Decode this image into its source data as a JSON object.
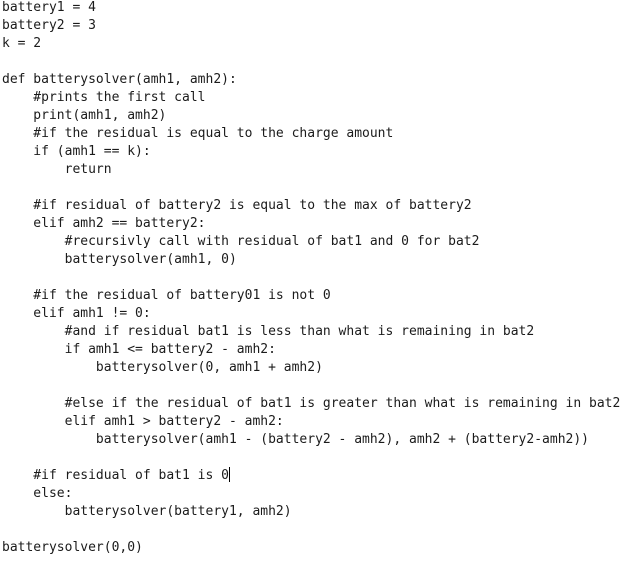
{
  "editor": {
    "text_color": "#1b1b1b",
    "background_color": "#ffffff",
    "caret": {
      "line_index": 26
    },
    "lines": [
      "battery1 = 4",
      "battery2 = 3",
      "k = 2",
      "",
      "def batterysolver(amh1, amh2):",
      "    #prints the first call",
      "    print(amh1, amh2)",
      "    #if the residual is equal to the charge amount",
      "    if (amh1 == k):",
      "        return",
      "",
      "    #if residual of battery2 is equal to the max of battery2",
      "    elif amh2 == battery2:",
      "        #recursivly call with residual of bat1 and 0 for bat2",
      "        batterysolver(amh1, 0)",
      "",
      "    #if the residual of battery01 is not 0",
      "    elif amh1 != 0:",
      "        #and if residual bat1 is less than what is remaining in bat2",
      "        if amh1 <= battery2 - amh2:",
      "            batterysolver(0, amh1 + amh2)",
      "",
      "        #else if the residual of bat1 is greater than what is remaining in bat2",
      "        elif amh1 > battery2 - amh2:",
      "            batterysolver(amh1 - (battery2 - amh2), amh2 + (battery2-amh2))",
      "",
      "    #if residual of bat1 is 0",
      "    else:",
      "        batterysolver(battery1, amh2)",
      "",
      "batterysolver(0,0)"
    ]
  }
}
